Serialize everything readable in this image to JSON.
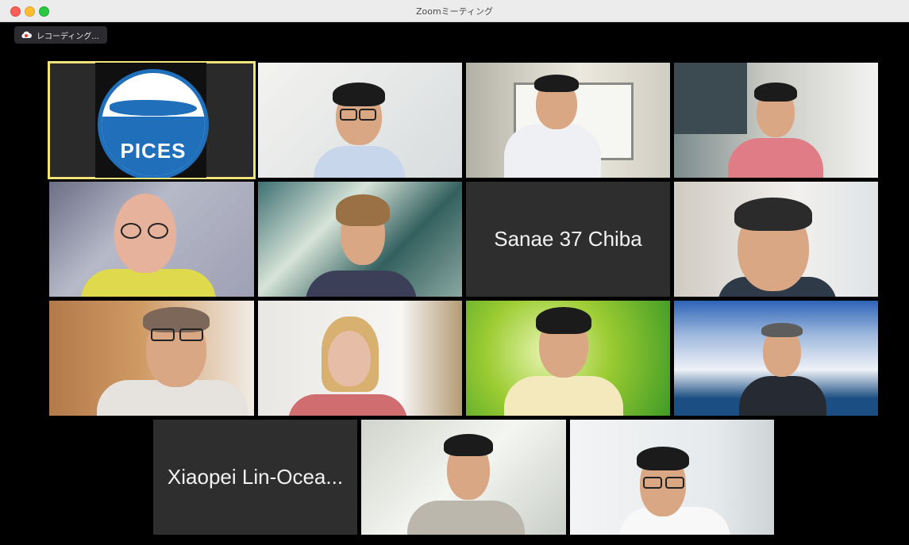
{
  "window": {
    "title": "Zoomミーティング",
    "recording_label": "レコーディング..."
  },
  "participants": {
    "logo_text": "PICES",
    "name_tile_1": "Sanae 37 Chiba",
    "name_tile_2": "Xiaopei Lin-Ocea..."
  },
  "colors": {
    "active_speaker_border": "#f2e27a",
    "pices_blue": "#1f6fba"
  },
  "icons": {
    "recording": "cloud-recording-icon"
  }
}
